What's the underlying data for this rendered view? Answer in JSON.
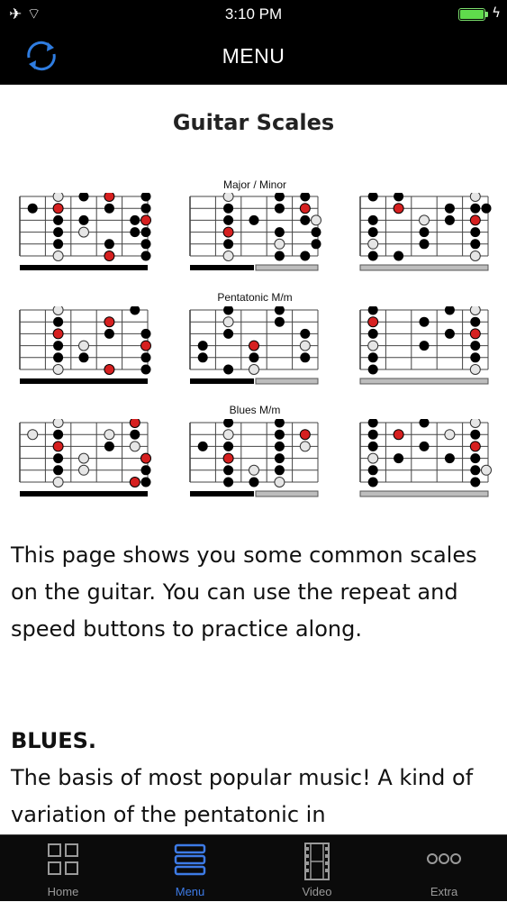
{
  "status": {
    "time": "3:10 PM"
  },
  "navbar": {
    "title": "MENU",
    "refresh_icon": "refresh-icon"
  },
  "page": {
    "heading": "Guitar Scales",
    "sections": [
      {
        "label": "Major / Minor"
      },
      {
        "label": "Pentatonic M/m"
      },
      {
        "label": "Blues M/m"
      }
    ],
    "paragraphs": [
      "This page shows you some common scales on the guitar. You can use the repeat and speed buttons to practice along.",
      "BLUES.",
      "The basis of most popular music!  A kind of variation of the pentatonic in"
    ]
  },
  "tabbar": {
    "tabs": [
      {
        "label": "Home",
        "icon": "grid-icon"
      },
      {
        "label": "Menu",
        "icon": "list-icon"
      },
      {
        "label": "Video",
        "icon": "film-icon"
      },
      {
        "label": "Extra",
        "icon": "more-icon"
      }
    ],
    "active": "Menu",
    "accent": "#3d7be6"
  }
}
